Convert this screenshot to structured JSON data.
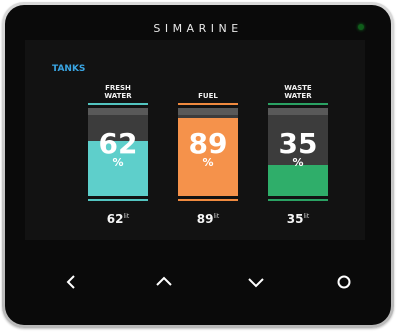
{
  "device": {
    "brand": "SIMARINE"
  },
  "screen": {
    "section_title": "TANKS",
    "tanks": [
      {
        "label": "FRESH\nWATER",
        "value": "62",
        "unit": "%",
        "level": 0.62,
        "volume": "62",
        "volume_unit": "lit",
        "color": "#5ecfcb",
        "line_color": "#53c5c1"
      },
      {
        "label": "FUEL",
        "value": "89",
        "unit": "%",
        "level": 0.89,
        "volume": "89",
        "volume_unit": "lit",
        "color": "#f5924b",
        "line_color": "#f08a3f"
      },
      {
        "label": "WASTE\nWATER",
        "value": "35",
        "unit": "%",
        "level": 0.35,
        "volume": "35",
        "volume_unit": "lit",
        "color": "#2fae6a",
        "line_color": "#2aa263"
      }
    ]
  },
  "controls": {
    "buttons": [
      {
        "name": "back-button",
        "icon": "chevron-left-icon"
      },
      {
        "name": "up-button",
        "icon": "chevron-up-icon"
      },
      {
        "name": "down-button",
        "icon": "chevron-down-icon"
      },
      {
        "name": "select-button",
        "icon": "circle-icon"
      }
    ]
  },
  "colors": {
    "accent": "#3aa6e4",
    "led": "#0f5d1a"
  }
}
